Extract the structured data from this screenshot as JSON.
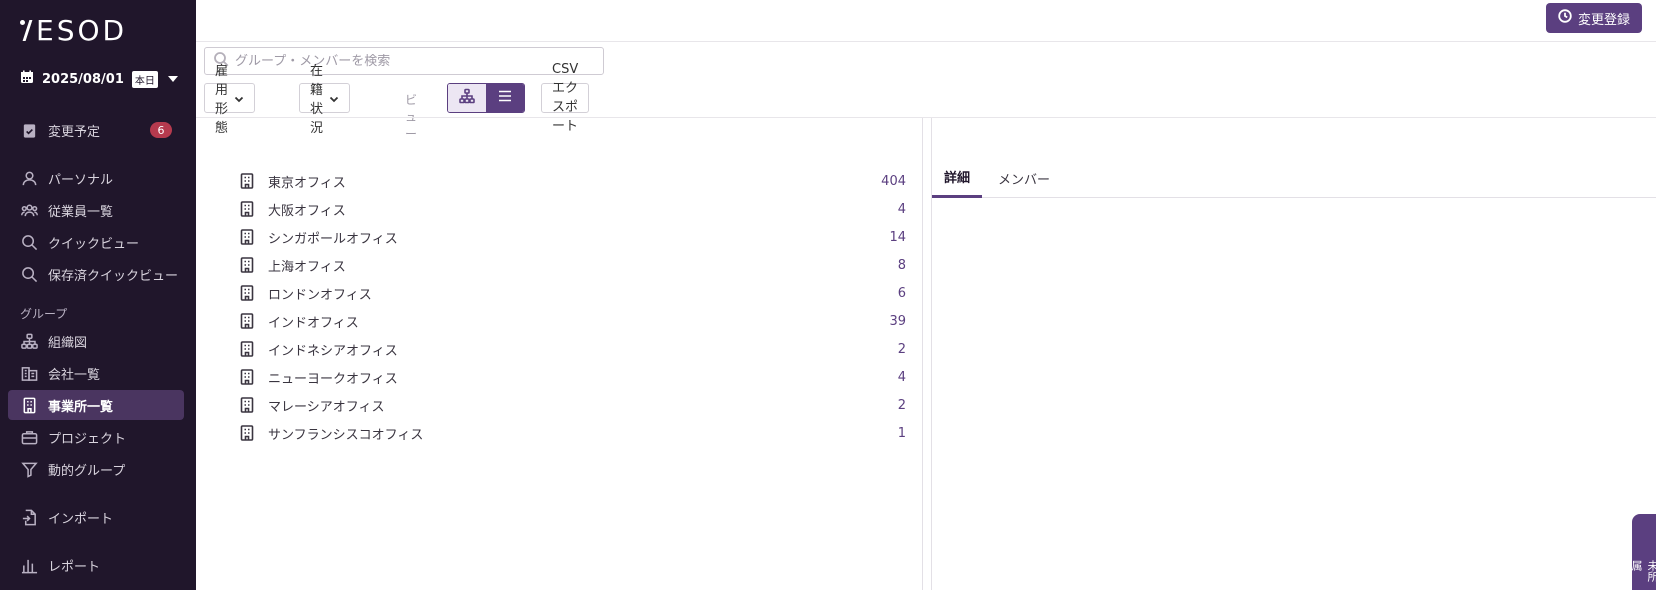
{
  "app": {
    "logo": "YESOD"
  },
  "date_picker": {
    "date": "2025/08/01",
    "today_label": "本日"
  },
  "sidebar": {
    "pending": {
      "label": "変更予定",
      "count": "6"
    },
    "items": [
      {
        "label": "パーソナル",
        "icon": "user-icon"
      },
      {
        "label": "従業員一覧",
        "icon": "users-icon"
      },
      {
        "label": "クイックビュー",
        "icon": "search-icon"
      },
      {
        "label": "保存済クイックビュー",
        "icon": "search-icon"
      }
    ],
    "group_section_label": "グループ",
    "group_items": [
      {
        "label": "組織図",
        "icon": "org-chart-icon"
      },
      {
        "label": "会社一覧",
        "icon": "company-icon"
      },
      {
        "label": "事業所一覧",
        "icon": "building-icon",
        "active": true
      },
      {
        "label": "プロジェクト",
        "icon": "briefcase-icon"
      },
      {
        "label": "動的グループ",
        "icon": "filter-icon"
      }
    ],
    "import_label": "インポート",
    "report_label": "レポート"
  },
  "header": {
    "register_change_label": "変更登録"
  },
  "search": {
    "placeholder": "グループ・メンバーを検索",
    "value": ""
  },
  "toolbar": {
    "employment_type_label": "雇用形態",
    "enrollment_status_label": "在籍状況",
    "view_label": "ビュー",
    "csv_export_label": "CSVエクスポート",
    "selected_view": "list"
  },
  "offices": [
    {
      "name": "東京オフィス",
      "count": "404"
    },
    {
      "name": "大阪オフィス",
      "count": "4"
    },
    {
      "name": "シンガポールオフィス",
      "count": "14"
    },
    {
      "name": "上海オフィス",
      "count": "8"
    },
    {
      "name": "ロンドンオフィス",
      "count": "6"
    },
    {
      "name": "インドオフィス",
      "count": "39"
    },
    {
      "name": "インドネシアオフィス",
      "count": "2"
    },
    {
      "name": "ニューヨークオフィス",
      "count": "4"
    },
    {
      "name": "マレーシアオフィス",
      "count": "2"
    },
    {
      "name": "サンフランシスコオフィス",
      "count": "1"
    }
  ],
  "detail": {
    "tabs": [
      {
        "label": "詳細",
        "active": true
      },
      {
        "label": "メンバー",
        "active": false
      }
    ]
  },
  "drawer_tab": {
    "label": "未所属"
  },
  "colors": {
    "sidebar_bg": "#20162b",
    "accent": "#5b3f80",
    "badge": "#b53a4e"
  }
}
